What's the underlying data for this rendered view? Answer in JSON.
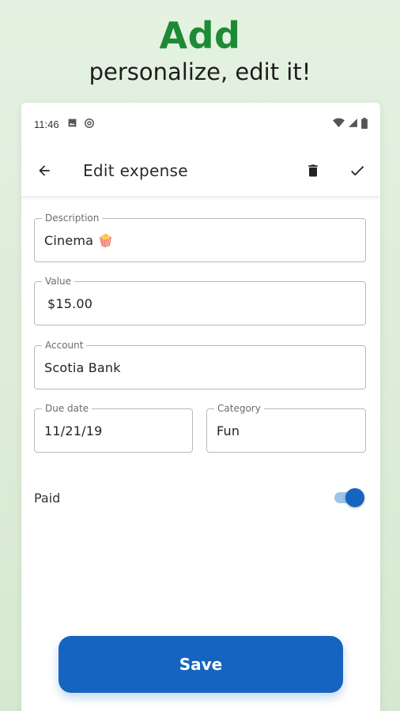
{
  "promo": {
    "title": "Add",
    "subtitle": "personalize, edit it!"
  },
  "status_bar": {
    "time": "11:46",
    "icons": [
      "image-icon",
      "at-sign-icon",
      "wifi-icon",
      "signal-icon",
      "battery-icon"
    ]
  },
  "app_bar": {
    "title": "Edit expense",
    "icons": [
      "back-arrow-icon",
      "delete-icon",
      "check-icon"
    ]
  },
  "form": {
    "description": {
      "label": "Description",
      "value": "Cinema 🍿"
    },
    "value": {
      "label": "Value",
      "value": "$15.00"
    },
    "account": {
      "label": "Account",
      "value": "Scotia Bank"
    },
    "due_date": {
      "label": "Due date",
      "value": "11/21/19"
    },
    "category": {
      "label": "Category",
      "value": "Fun"
    },
    "paid": {
      "label": "Paid",
      "checked": true
    }
  },
  "save_label": "Save",
  "colors": {
    "accent": "#1565c0",
    "promo_green": "#1f8a35",
    "background": "#dcecd8"
  }
}
